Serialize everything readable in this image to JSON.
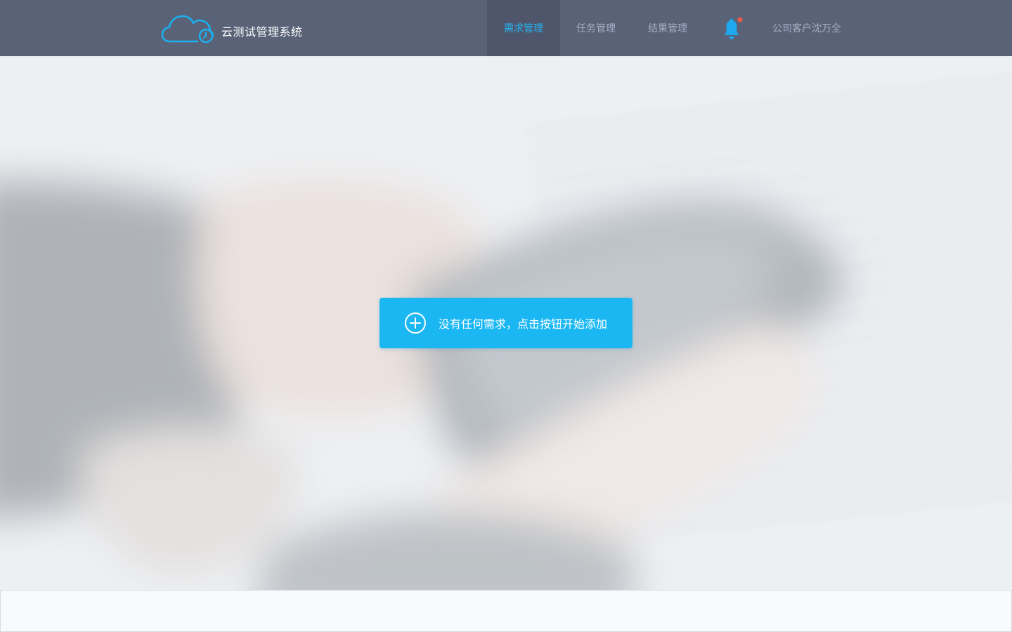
{
  "app": {
    "title": "云测试管理系统",
    "logo_icon": "cloud-clock-logo-icon"
  },
  "nav": {
    "items": [
      {
        "label": "需求管理",
        "active": true
      },
      {
        "label": "任务管理",
        "active": false
      },
      {
        "label": "结果管理",
        "active": false
      }
    ]
  },
  "notifications": {
    "icon": "bell-icon",
    "has_unread": true
  },
  "user": {
    "name": "公司客户沈万全"
  },
  "main": {
    "empty_state_button": {
      "label": "没有任何需求，点击按钮开始添加",
      "icon": "plus-circle-icon"
    }
  },
  "colors": {
    "header_bg": "#596277",
    "nav_active_bg": "#4f566c",
    "accent": "#1bb7f3",
    "nav_text": "#a5b0c5",
    "badge": "#f15a4a"
  }
}
